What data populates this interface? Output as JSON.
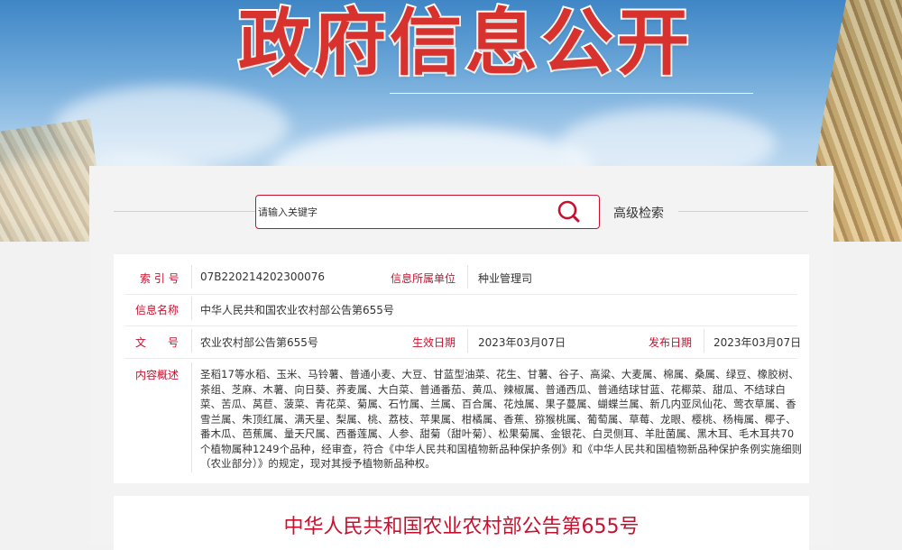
{
  "banner": {
    "title": "政府信息公开"
  },
  "search": {
    "placeholder": "请输入关键字",
    "advanced_label": "高级检索"
  },
  "meta": {
    "index_label": "索 引 号",
    "index_value": "07B220214202300076",
    "owner_label": "信息所属单位",
    "owner_value": "种业管理司",
    "name_label": "信息名称",
    "name_value": "中华人民共和国农业农村部公告第655号",
    "doc_label": "文　　号",
    "doc_value": "农业农村部公告第655号",
    "effective_label": "生效日期",
    "effective_value": "2023年03月07日",
    "publish_label": "发布日期",
    "publish_value": "2023年03月07日",
    "summary_label": "内容概述",
    "summary_value": "圣稻17等水稻、玉米、马铃薯、普通小麦、大豆、甘蓝型油菜、花生、甘薯、谷子、高粱、大麦属、棉属、桑属、绿豆、橡胶树、茶组、芝麻、木薯、向日葵、荞麦属、大白菜、普通番茄、黄瓜、辣椒属、普通西瓜、普通结球甘蓝、花椰菜、甜瓜、不结球白菜、苦瓜、莴苣、菠菜、青花菜、菊属、石竹属、兰属、百合属、花烛属、果子蔓属、蝴蝶兰属、新几内亚凤仙花、莺衣草属、香雪兰属、朱顶红属、满天星、梨属、桃、荔枝、苹果属、柑橘属、香蕉、猕猴桃属、葡萄属、草莓、龙眼、樱桃、杨梅属、椰子、番木瓜、芭蕉属、量天尺属、西番莲属、人参、甜菊（甜叶菊）、松果菊属、金银花、白灵侧耳、羊肚菌属、黑木耳、毛木耳共70个植物属种1249个品种，经审查，符合《中华人民共和国植物新品种保护条例》和《中华人民共和国植物新品种保护条例实施细则（农业部分）》的规定，现对其授予植物新品种权。"
  },
  "article": {
    "title": "中华人民共和国农业农村部公告第655号"
  },
  "colors": {
    "accent": "#c8102e",
    "title_red": "#d8322e"
  }
}
